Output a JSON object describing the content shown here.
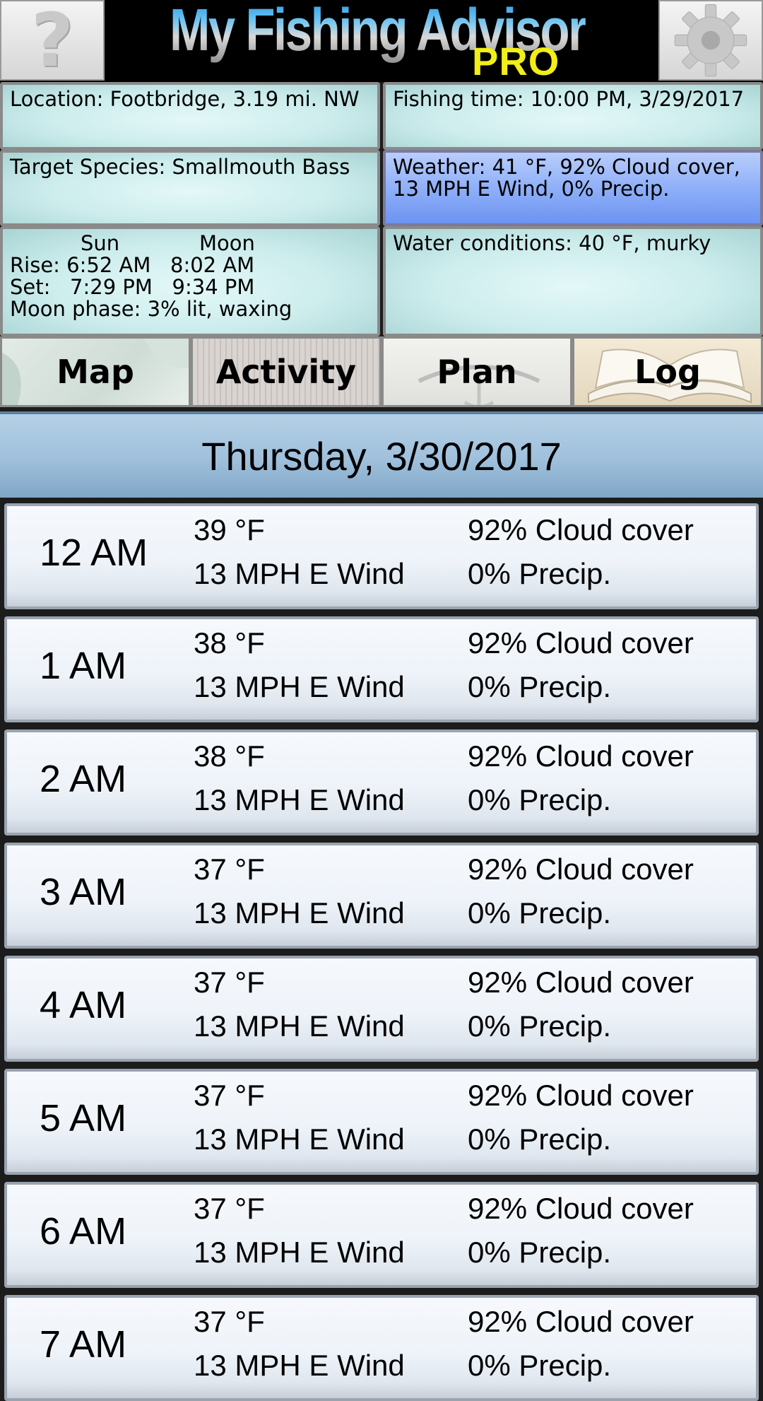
{
  "header": {
    "title": "My Fishing Advisor",
    "badge": "PRO",
    "help_icon": "question-mark-icon",
    "settings_icon": "gear-icon"
  },
  "panels": {
    "location": "Location: Footbridge, 3.19 mi. NW",
    "fishing_time": "Fishing time: 10:00 PM, 3/29/2017",
    "target_species": "Target Species: Smallmouth Bass",
    "weather": "Weather:  41 °F, 92% Cloud cover, 13 MPH E Wind, 0% Precip.",
    "sun_moon": {
      "sun_label": "Sun",
      "moon_label": "Moon",
      "rise_line": "Rise: 6:52 AM   8:02 AM",
      "set_line": "Set:   7:29 PM   9:34 PM",
      "moon_phase": "Moon phase: 3% lit, waxing"
    },
    "water": "Water conditions: 40 °F, murky"
  },
  "tabs": [
    {
      "label": "Map"
    },
    {
      "label": "Activity"
    },
    {
      "label": "Plan"
    },
    {
      "label": "Log"
    }
  ],
  "date_header": "Thursday, 3/30/2017",
  "hours": [
    {
      "time": "12 AM",
      "temp": "39 °F",
      "wind": "13 MPH E Wind",
      "cloud": "92% Cloud cover",
      "precip": "0% Precip."
    },
    {
      "time": "1 AM",
      "temp": "38 °F",
      "wind": "13 MPH E Wind",
      "cloud": "92% Cloud cover",
      "precip": "0% Precip."
    },
    {
      "time": "2 AM",
      "temp": "38 °F",
      "wind": "13 MPH E Wind",
      "cloud": "92% Cloud cover",
      "precip": "0% Precip."
    },
    {
      "time": "3 AM",
      "temp": "37 °F",
      "wind": "13 MPH E Wind",
      "cloud": "92% Cloud cover",
      "precip": "0% Precip."
    },
    {
      "time": "4 AM",
      "temp": "37 °F",
      "wind": "13 MPH E Wind",
      "cloud": "92% Cloud cover",
      "precip": "0% Precip."
    },
    {
      "time": "5 AM",
      "temp": "37 °F",
      "wind": "13 MPH E Wind",
      "cloud": "92% Cloud cover",
      "precip": "0% Precip."
    },
    {
      "time": "6 AM",
      "temp": "37 °F",
      "wind": "13 MPH E Wind",
      "cloud": "92% Cloud cover",
      "precip": "0% Precip."
    },
    {
      "time": "7 AM",
      "temp": "37 °F",
      "wind": "13 MPH E Wind",
      "cloud": "92% Cloud cover",
      "precip": "0% Precip."
    }
  ]
}
